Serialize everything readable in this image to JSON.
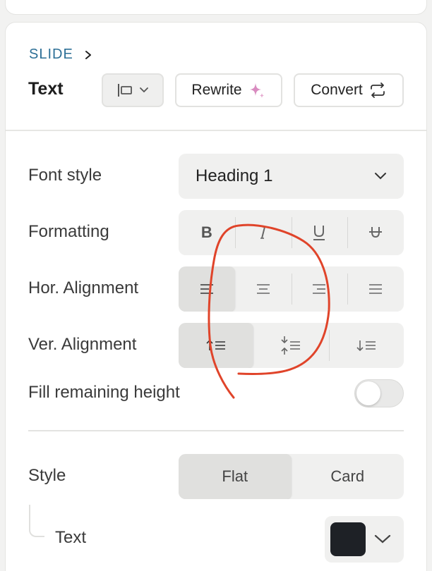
{
  "panel": {
    "breadcrumb": "SLIDE",
    "title": "Text"
  },
  "toolbar": {
    "rewrite_label": "Rewrite",
    "convert_label": "Convert"
  },
  "rows": {
    "font_style": {
      "label": "Font style",
      "value": "Heading 1"
    },
    "formatting": {
      "label": "Formatting",
      "buttons": [
        "B",
        "I",
        "U",
        "S"
      ]
    },
    "hor_alignment": {
      "label": "Hor. Alignment",
      "options": [
        "left",
        "center",
        "right",
        "justify"
      ],
      "selected": "left"
    },
    "ver_alignment": {
      "label": "Ver. Alignment",
      "options": [
        "top",
        "middle",
        "bottom"
      ],
      "selected": "top"
    },
    "fill_remaining_height": {
      "label": "Fill remaining height",
      "on": false
    }
  },
  "style": {
    "label": "Style",
    "options": [
      "Flat",
      "Card"
    ],
    "selected": "Flat"
  },
  "text_color": {
    "label": "Text",
    "value": "#1e2126"
  },
  "colors": {
    "accent_link": "#2c6f96",
    "annotation": "#e0442a",
    "sparkle": "#d98cc0"
  }
}
